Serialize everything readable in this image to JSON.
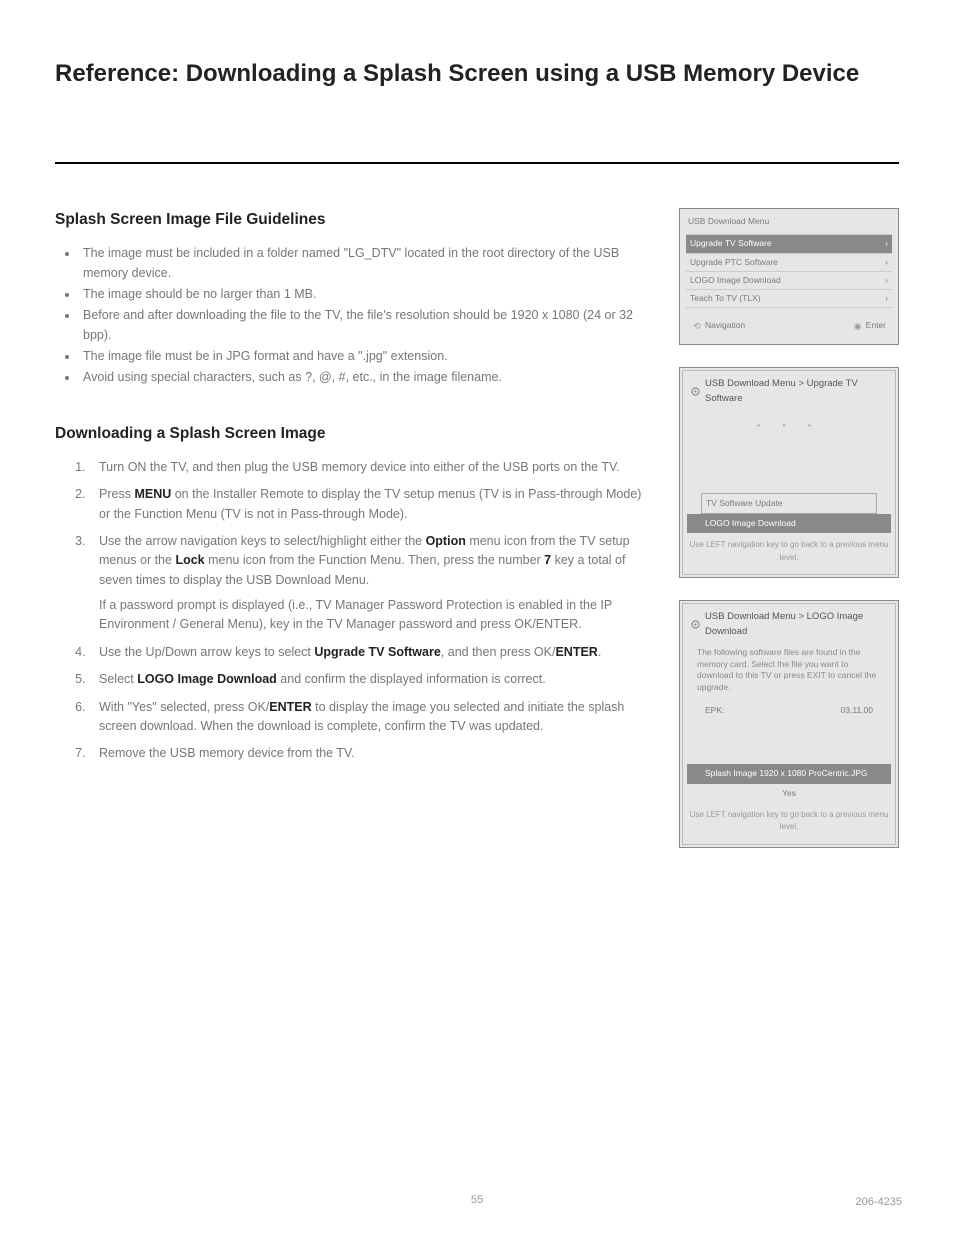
{
  "title": "Reference: Downloading a Splash Screen using a USB Memory Device",
  "section1": {
    "heading": "Splash Screen Image File Guidelines",
    "bul1": "The image must be included in a folder named \"LG_DTV\" located in the root directory of the USB memory device.",
    "bul2": "The image should be no larger than 1 MB.",
    "bul3": "Before and after downloading the file to the TV, the file's resolution should be 1920 x 1080 (24 or 32 bpp).",
    "bul4": "The image file must be in JPG format and have a \".jpg\" extension.",
    "bul5": "Avoid using special characters, such as ?, @, #, etc., in the image filename."
  },
  "section2": {
    "heading": "Downloading a Splash Screen Image",
    "step1": "Turn ON the TV, and then plug the USB memory device into either of the USB ports on the TV.",
    "step2a": "Press ",
    "step2b": " on the Installer Remote to display the TV setup menus (TV is in Pass‑through Mode) or the Function Menu (TV is not in Pass‑through Mode).",
    "step3a": "Use the arrow navigation keys to select/highlight either the ",
    "step3b": " menu icon from the TV setup menus or the ",
    "step3c": " menu icon from the Function Menu. Then, press the number ",
    "step3d": " key a total of seven times to display the USB Download Menu.",
    "note": "If a password prompt is displayed (i.e., TV Manager Password Protection is enabled in the IP Environment / General Menu), key in the TV Manager password and press OK/ENTER.",
    "step4a": "Use the Up/Down arrow keys to select ",
    "step4b": ", and then press OK/",
    "step4c": ".",
    "step5a": "Select ",
    "step5b": " and confirm the displayed information is correct.",
    "step6a": "With \"Yes\" selected, press OK/",
    "step6b": " to display the image you selected and initiate the splash screen download. When the download is complete, confirm the TV was updated.",
    "step7": "Remove the USB memory device from the TV."
  },
  "bold": {
    "menu": "MENU",
    "option": "Option",
    "lock": "Lock",
    "seven": "7",
    "upgrade": "Upgrade TV Software",
    "enter": "ENTER",
    "logo": "LOGO Image Download"
  },
  "fig1": {
    "title": "USB Download Menu",
    "r1l": "Upgrade TV Software",
    "r1r": "›",
    "r2l": "Upgrade PTC Software",
    "r2r": "›",
    "r3l": "LOGO Image Download",
    "r3r": "›",
    "r4l": "Teach To TV (TLX)",
    "r4r": "›",
    "navL": "Navigation",
    "navR": "Enter"
  },
  "fig2": {
    "title": "USB Download Menu > Upgrade TV Software",
    "dots": "• • •",
    "unsel": "TV Software Update",
    "sel": "LOGO Image Download",
    "caption": "Use LEFT navigation key to go back to a previous menu level."
  },
  "fig3": {
    "title": "USB Download Menu > LOGO Image Download",
    "r1l": "The following software files are found in the memory card. Select the file you want to download to this TV or press EXIT to cancel the upgrade.",
    "r_epk": "EPK:",
    "r_epkv": "03.11.00",
    "r_sel": "Splash Image 1920 x 1080 ProCentric.JPG",
    "r_yes": "Yes",
    "caption": "Use LEFT navigation key to go back to a previous menu level."
  },
  "pagenum": "55",
  "corner": "206‑4235"
}
